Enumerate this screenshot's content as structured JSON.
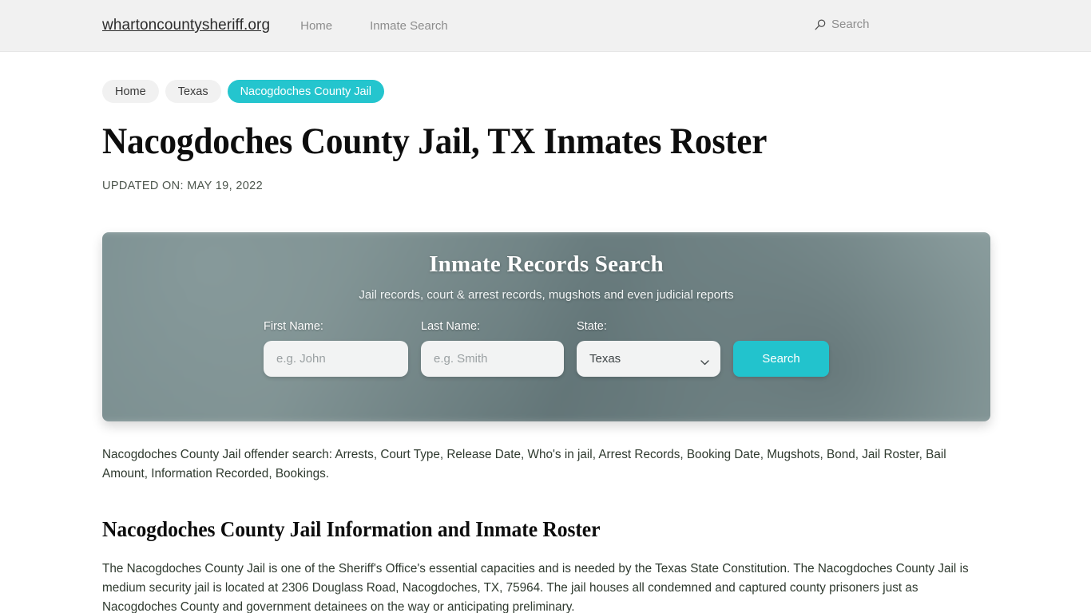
{
  "header": {
    "brand": "whartoncountysheriff.org",
    "nav": [
      {
        "label": "Home"
      },
      {
        "label": "Inmate Search"
      }
    ],
    "search_label": "Search",
    "search_icon": "search-icon"
  },
  "breadcrumb": [
    {
      "label": "Home",
      "active": false
    },
    {
      "label": "Texas",
      "active": false
    },
    {
      "label": "Nacogdoches County Jail",
      "active": true
    }
  ],
  "page": {
    "title": "Nacogdoches County Jail, TX Inmates Roster",
    "updated": "UPDATED ON: MAY 19, 2022"
  },
  "widget": {
    "title": "Inmate Records Search",
    "subtitle": "Jail records, court & arrest records, mugshots and even judicial reports",
    "first_name_label": "First Name:",
    "first_name_placeholder": "e.g. John",
    "first_name_value": "",
    "last_name_label": "Last Name:",
    "last_name_placeholder": "e.g. Smith",
    "last_name_value": "",
    "state_label": "State:",
    "state_selected": "Texas",
    "state_options": [
      "Texas"
    ],
    "search_button": "Search",
    "accent_color": "#22c3cd"
  },
  "content": {
    "lede": "Nacogdoches County Jail offender search: Arrests, Court Type, Release Date, Who's in jail, Arrest Records, Booking Date, Mugshots, Bond, Jail Roster, Bail Amount, Information Recorded, Bookings.",
    "section_title": "Nacogdoches County Jail Information and Inmate Roster",
    "body": "The Nacogdoches County Jail is one of the Sheriff's Office's essential capacities and is needed by the Texas State Constitution. The Nacogdoches County Jail is medium security jail is located at 2306 Douglass Road, Nacogdoches, TX, 75964. The jail houses all condemned and captured county prisoners just as Nacogdoches County and government detainees on the way or anticipating preliminary."
  }
}
